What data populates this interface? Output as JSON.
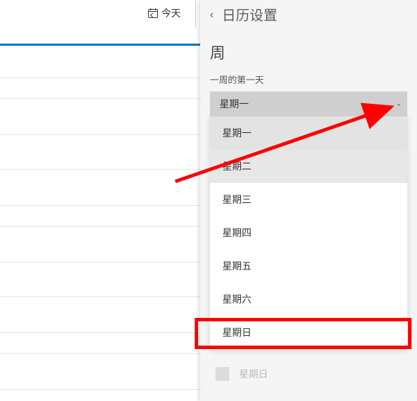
{
  "today_label": "今天",
  "panel_title": "日历设置",
  "section_heading": "周",
  "section_label": "一周的第一天",
  "dropdown_selected": "星期一",
  "dropdown_items": [
    "星期一",
    "星期二",
    "星期三",
    "星期四",
    "星期五",
    "星期六",
    "星期日"
  ],
  "sunday_checkbox_label": "星期日"
}
